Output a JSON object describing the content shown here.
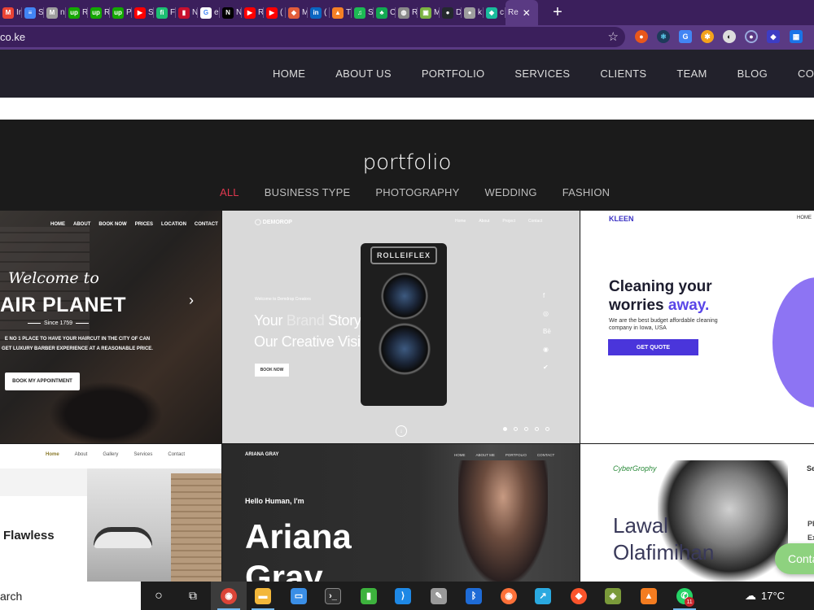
{
  "browser": {
    "tabs": [
      {
        "icon": "gmail-icon",
        "label": "M",
        "title": "In",
        "color": "#ea4335"
      },
      {
        "icon": "google-docs-icon",
        "label": "≡",
        "title": "S",
        "color": "#4285f4"
      },
      {
        "icon": "gmail-icon",
        "label": "M",
        "title": "n",
        "color": "#9e9e9e"
      },
      {
        "icon": "upwork-icon",
        "label": "up",
        "title": "R",
        "color": "#14a800"
      },
      {
        "icon": "upwork-icon",
        "label": "up",
        "title": "R",
        "color": "#14a800"
      },
      {
        "icon": "upwork-icon",
        "label": "up",
        "title": "P",
        "color": "#14a800"
      },
      {
        "icon": "youtube-icon",
        "label": "▶",
        "title": "S",
        "color": "#ff0000"
      },
      {
        "icon": "fiverr-icon",
        "label": "fi",
        "title": "F",
        "color": "#1dbf73"
      },
      {
        "icon": "nba-icon",
        "label": "▮",
        "title": "N",
        "color": "#c8102e"
      },
      {
        "icon": "google-icon",
        "label": "G",
        "title": "e",
        "color": "#ffffff"
      },
      {
        "icon": "notion-icon",
        "label": "N",
        "title": "N",
        "color": "#000000"
      },
      {
        "icon": "youtube-icon",
        "label": "▶",
        "title": "R",
        "color": "#ff0000"
      },
      {
        "icon": "youtube-icon",
        "label": "▶",
        "title": "(",
        "color": "#ff0000"
      },
      {
        "icon": "book-icon",
        "label": "◆",
        "title": "M",
        "color": "#e35d3b"
      },
      {
        "icon": "linkedin-icon",
        "label": "in",
        "title": "(",
        "color": "#0a66c2"
      },
      {
        "icon": "fire-icon",
        "label": "▲",
        "title": "T",
        "color": "#f58025"
      },
      {
        "icon": "spotify-icon",
        "label": "♫",
        "title": "S",
        "color": "#1db954"
      },
      {
        "icon": "leaf-icon",
        "label": "♣",
        "title": "C",
        "color": "#13aa52"
      },
      {
        "icon": "globe-icon",
        "label": "◍",
        "title": "R",
        "color": "#8a8a8a"
      },
      {
        "icon": "image-icon",
        "label": "▣",
        "title": "M",
        "color": "#7cb342"
      },
      {
        "icon": "github-icon",
        "label": "●",
        "title": "D",
        "color": "#24292e"
      },
      {
        "icon": "circle-icon",
        "label": "●",
        "title": "k",
        "color": "#9e9e9e"
      },
      {
        "icon": "diamond-icon",
        "label": "◆",
        "title": "c",
        "color": "#1abc9c"
      }
    ],
    "active_tab": {
      "title": "Re",
      "close": "✕"
    },
    "new_tab": "+",
    "url": "co.ke",
    "star": "☆"
  },
  "site": {
    "nav": [
      "HOME",
      "ABOUT US",
      "PORTFOLIO",
      "SERVICES",
      "CLIENTS",
      "TEAM",
      "BLOG",
      "CONTA"
    ]
  },
  "portfolio": {
    "title": "portfolio",
    "filters": [
      {
        "label": "ALL",
        "active": true
      },
      {
        "label": "BUSINESS TYPE",
        "active": false
      },
      {
        "label": "PHOTOGRAPHY",
        "active": false
      },
      {
        "label": "WEDDING",
        "active": false
      },
      {
        "label": "FASHION",
        "active": false
      }
    ],
    "barber": {
      "nav": [
        "HOME",
        "ABOUT",
        "BOOK NOW",
        "PRICES",
        "LOCATION",
        "CONTACT"
      ],
      "welcome": "Welcome to",
      "headline": "AIR PLANET",
      "since": "Since 1759",
      "desc": "E NO 1 PLACE TO HAVE YOUR HAIRCUT IN THE CITY OF CAN GET LUXURY BARBER EXPERIENCE AT A REASONABLE PRICE.",
      "cta": "BOOK MY APPOINTMENT",
      "arrow": "›"
    },
    "camera": {
      "logo": "◯ DEMOROP",
      "nav": [
        "Home",
        "About",
        "Project",
        "Contact"
      ],
      "kicker": "Welcome to Demdrop Creators",
      "headline_1": "Your ",
      "headline_brand": "Brand",
      "headline_2": " Story,",
      "headline_3": "Our Creative Vision.",
      "cta": "BOOK NOW",
      "plate": "ROLLEIFLEX",
      "socials": [
        "f",
        "◎",
        "Bē",
        "◉",
        "✔"
      ],
      "down": "↓"
    },
    "kleen": {
      "brand": "KLEEN",
      "home": "HOME",
      "h1_line1": "Cleaning your",
      "h1_line2a": "worries ",
      "h1_line2b": "away.",
      "sub": "We are the best budget affordable cleaning company in Iowa, USA",
      "cta": "GET QUOTE",
      "accent": "#5a46e8"
    },
    "gallery": {
      "nav": [
        "Home",
        "About",
        "Gallery",
        "Services",
        "Contact"
      ],
      "headline": "Flawless"
    },
    "ariana": {
      "brand": "ARIANA GRAY",
      "nav": [
        "HOME",
        "ABOUT ME",
        "PORTFOLIO",
        "CONTACT"
      ],
      "hello": "Hello Human, I'm",
      "name_1": "Ariana",
      "name_2": "Gray"
    },
    "lawal": {
      "brand": "CyberGrophy",
      "corner": "Se",
      "name_1": "Lawal",
      "name_2": "Olafimihan",
      "side": [
        "Ph",
        "Ex"
      ]
    }
  },
  "contact_fab": "Conta",
  "taskbar": {
    "search": "arch",
    "weather": "17°C",
    "whatsapp_badge": "11"
  }
}
